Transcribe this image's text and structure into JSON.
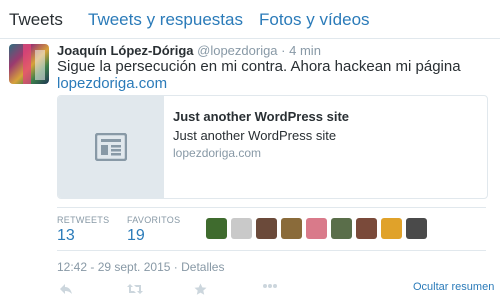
{
  "tabs": [
    {
      "label": "Tweets",
      "active": true
    },
    {
      "label": "Tweets y respuestas",
      "active": false
    },
    {
      "label": "Fotos y vídeos",
      "active": false
    }
  ],
  "tweet": {
    "fullname": "Joaquín López-Dóriga",
    "screen_name": "@lopezdoriga",
    "separator": "·",
    "time": "4 min",
    "text": "Sigue la persecución en mi contra. Ahora hackean mi página",
    "url": "lopezdoriga.com",
    "card": {
      "icon": "article-icon",
      "title": "Just another WordPress site",
      "description": "Just another WordPress site",
      "domain": "lopezdoriga.com"
    },
    "stats": {
      "retweets_label": "RETWEETS",
      "retweets_value": "13",
      "favorites_label": "FAVORITOS",
      "favorites_value": "19"
    },
    "favoriters": [
      {
        "name": "favoriter-avatar",
        "color": "#3f6b2e"
      },
      {
        "name": "favoriter-avatar",
        "color": "#c9c9c9"
      },
      {
        "name": "favoriter-avatar",
        "color": "#6b4a3a"
      },
      {
        "name": "favoriter-avatar",
        "color": "#8a6b3a"
      },
      {
        "name": "favoriter-avatar",
        "color": "#d97a8a"
      },
      {
        "name": "favoriter-avatar",
        "color": "#5a6e4a"
      },
      {
        "name": "favoriter-avatar",
        "color": "#7a4a3a"
      },
      {
        "name": "favoriter-avatar",
        "color": "#e0a22a"
      },
      {
        "name": "favoriter-avatar",
        "color": "#4a4a4a"
      }
    ],
    "timestamp": "12:42 - 29 sept. 2015",
    "details_link": "Detalles",
    "collapse_label": "Ocultar resumen"
  },
  "colors": {
    "link": "#2b7bb9",
    "muted": "#8899a6",
    "text": "#292f33",
    "border": "#e1e8ed"
  },
  "actions": [
    "reply-icon",
    "retweet-icon",
    "favorite-icon",
    "more-icon"
  ]
}
